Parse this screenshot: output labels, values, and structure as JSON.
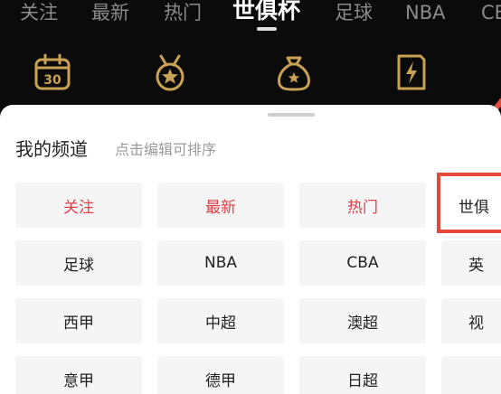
{
  "top_tabs": [
    "关注",
    "最新",
    "热门",
    "世俱杯",
    "足球",
    "NBA",
    "CB"
  ],
  "active_tab_index": 3,
  "icons": [
    "calendar-30-icon",
    "medal-star-icon",
    "money-bag-icon",
    "lightning-card-icon"
  ],
  "sheet": {
    "title": "我的频道",
    "hint": "点击编辑可排序"
  },
  "channels": [
    [
      "关注",
      "最新",
      "热门",
      "世俱"
    ],
    [
      "足球",
      "NBA",
      "CBA",
      "英"
    ],
    [
      "西甲",
      "中超",
      "澳超",
      "视"
    ],
    [
      "意甲",
      "德甲",
      "日超",
      ""
    ]
  ],
  "red_channels": [
    "关注",
    "最新",
    "热门"
  ],
  "colors": {
    "accent_red": "#e0404a",
    "gold": "#c9a256",
    "highlight_border": "#e34a3b"
  }
}
